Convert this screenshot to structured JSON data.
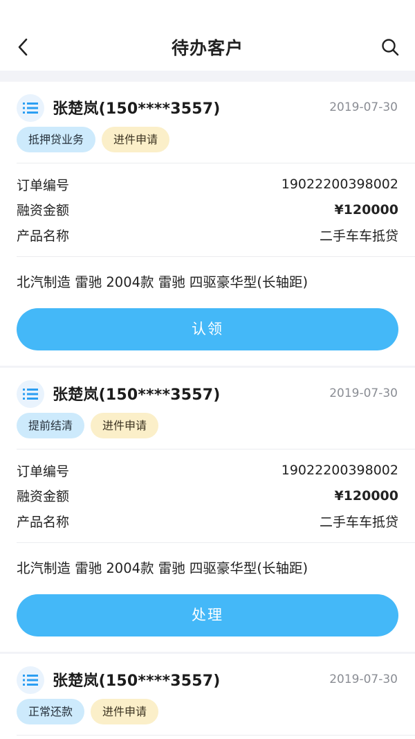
{
  "header": {
    "title": "待办客户",
    "back_icon": "chevron-left-icon",
    "search_icon": "search-icon"
  },
  "labels": {
    "order_no": "订单编号",
    "amount": "融资金额",
    "product": "产品名称"
  },
  "colors": {
    "primary": "#44b8f8",
    "tag_blue": "#cdeafc",
    "tag_yellow": "#fbefc9",
    "page_bg": "#f2f3f7"
  },
  "cards": [
    {
      "name": "张楚岚(150****3557)",
      "date": "2019-07-30",
      "tags": [
        "抵押贷业务",
        "进件申请"
      ],
      "order_no": "19022200398002",
      "amount": "¥120000",
      "product": "二手车车抵贷",
      "car": "北汽制造  雷驰 2004款 雷驰 四驱豪华型(长轴距)",
      "action": "认领"
    },
    {
      "name": "张楚岚(150****3557)",
      "date": "2019-07-30",
      "tags": [
        "提前结清",
        "进件申请"
      ],
      "order_no": "19022200398002",
      "amount": "¥120000",
      "product": "二手车车抵贷",
      "car": "北汽制造  雷驰 2004款 雷驰 四驱豪华型(长轴距)",
      "action": "处理"
    },
    {
      "name": "张楚岚(150****3557)",
      "date": "2019-07-30",
      "tags": [
        "正常还款",
        "进件申请"
      ]
    }
  ]
}
